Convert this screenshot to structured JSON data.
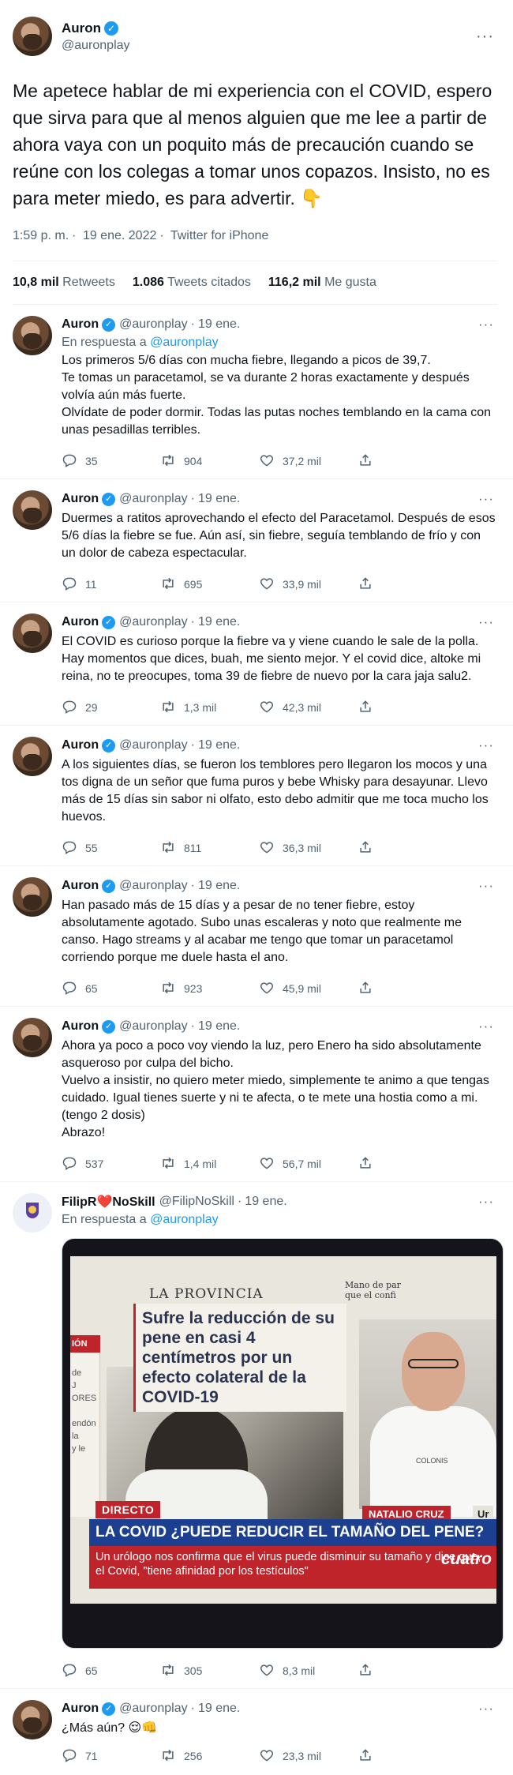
{
  "main_tweet": {
    "name": "Auron",
    "handle": "@auronplay",
    "text": "Me apetece hablar de mi experiencia con el COVID, espero que sirva para que al menos alguien que me lee a partir de ahora vaya con un poquito más de precaución cuando se reúne con los colegas a tomar unos copazos. Insisto, no es para meter miedo, es para advertir. 👇",
    "time": "1:59 p. m.",
    "date": "19 ene. 2022",
    "source": "Twitter for iPhone",
    "retweets_count": "10,8 mil",
    "retweets_label": "Retweets",
    "quotes_count": "1.086",
    "quotes_label": "Tweets citados",
    "likes_count": "116,2 mil",
    "likes_label": "Me gusta"
  },
  "replies": [
    {
      "name": "Auron",
      "handle": "@auronplay",
      "date": "19 ene.",
      "in_reply_prefix": "En respuesta a",
      "in_reply_handle": "@auronplay",
      "text": "Los primeros 5/6 días con mucha fiebre, llegando a picos de 39,7.\nTe tomas un paracetamol, se va durante 2 horas exactamente y después volvía aún más fuerte.\nOlvídate de poder dormir. Todas las putas noches temblando en la cama con unas pesadillas terribles.",
      "replies": "35",
      "retweets": "904",
      "likes": "37,2 mil"
    },
    {
      "name": "Auron",
      "handle": "@auronplay",
      "date": "19 ene.",
      "text": "Duermes a ratitos aprovechando el efecto del Paracetamol. Después de esos 5/6 días la fiebre se fue. Aún así, sin fiebre, seguía temblando de frío y con un dolor de cabeza espectacular.",
      "replies": "11",
      "retweets": "695",
      "likes": "33,9 mil"
    },
    {
      "name": "Auron",
      "handle": "@auronplay",
      "date": "19 ene.",
      "text": "El COVID es curioso porque la fiebre va y viene cuando le sale de la polla. Hay momentos que dices, buah, me siento mejor. Y el covid dice, altoke mi reina, no te preocupes, toma 39 de fiebre de nuevo por la cara jaja salu2.",
      "replies": "29",
      "retweets": "1,3 mil",
      "likes": "42,3 mil"
    },
    {
      "name": "Auron",
      "handle": "@auronplay",
      "date": "19 ene.",
      "text": "A los siguientes días, se fueron los temblores pero llegaron los mocos y una tos digna de un señor que fuma puros y bebe Whisky para desayunar. Llevo más de 15 días sin sabor ni olfato, esto debo admitir que me toca mucho los huevos.",
      "replies": "55",
      "retweets": "811",
      "likes": "36,3 mil"
    },
    {
      "name": "Auron",
      "handle": "@auronplay",
      "date": "19 ene.",
      "text": "Han pasado más de 15 días y a pesar de no tener fiebre, estoy absolutamente agotado. Subo unas escaleras y noto que realmente me canso. Hago streams y al acabar me tengo que tomar un paracetamol corriendo porque me duele hasta el ano.",
      "replies": "65",
      "retweets": "923",
      "likes": "45,9 mil"
    },
    {
      "name": "Auron",
      "handle": "@auronplay",
      "date": "19 ene.",
      "text": "Ahora ya poco a poco voy viendo la luz, pero Enero ha sido absolutamente asqueroso por culpa del bicho.\nVuelvo a insistir, no quiero meter miedo, simplemente te animo a que tengas cuidado. Igual tienes suerte y ni te afecta, o te mete una hostia como a mi. (tengo 2 dosis)\nAbrazo!",
      "replies": "537",
      "retweets": "1,4 mil",
      "likes": "56,7 mil"
    }
  ],
  "filip_reply": {
    "name_part1": "FilipR",
    "heart": "❤️",
    "name_part2": "NoSkill",
    "handle": "@FilipNoSkill",
    "date": "19 ene.",
    "in_reply_prefix": "En respuesta a",
    "in_reply_handle": "@auronplay",
    "media": {
      "paper_name": "LA PROVINCIA",
      "headline": "Sufre la reducción de su pene en casi 4 centímetros por un efecto colateral de la COVID-19",
      "side_box_text": "Mano de par que el confi",
      "left_bar_label": "IÓN",
      "left_text": "de\nJ\nORES\n\nendón\nla\ny le",
      "doctor_label": "COLONIS",
      "directo_label": "DIRECTO",
      "name_caption": "NATALIO CRUZ",
      "name_caption_suffix": "Ur",
      "band_title": "LA COVID ¿PUEDE REDUCIR EL TAMAÑO DEL PENE?",
      "band_subtitle": "Un urólogo nos confirma que el virus puede disminuir su tamaño y dice que, el Covid, \"tiene afinidad por los testículos\"",
      "channel": "cuatro"
    },
    "replies": "65",
    "retweets": "305",
    "likes": "8,3 mil"
  },
  "last_reply": {
    "name": "Auron",
    "handle": "@auronplay",
    "date": "19 ene.",
    "text": "¿Más aún? 😌👊",
    "replies": "71",
    "retweets": "256",
    "likes": "23,3 mil"
  },
  "colors": {
    "accent": "#1d9bf0",
    "muted": "#536471",
    "text": "#0f1419"
  }
}
